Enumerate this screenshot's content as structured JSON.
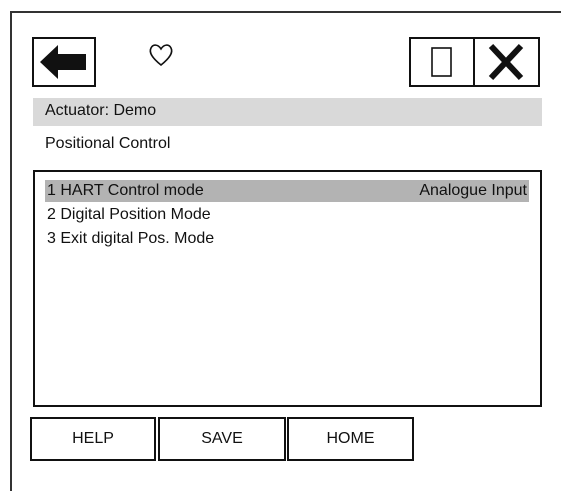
{
  "toolbar": {
    "back_icon": "arrow-left-icon",
    "favorite_icon": "heart-outline-icon",
    "window_icon": "window-icon",
    "close_icon": "close-icon"
  },
  "header": {
    "actuator_label": "Actuator: Demo"
  },
  "page": {
    "title": "Positional Control"
  },
  "menu": {
    "items": [
      {
        "label": "1 HART Control mode",
        "value": "Analogue Input",
        "selected": true
      },
      {
        "label": "2 Digital Position Mode",
        "value": "",
        "selected": false
      },
      {
        "label": "3 Exit digital Pos. Mode",
        "value": "",
        "selected": false
      }
    ]
  },
  "footer": {
    "help_label": "HELP",
    "save_label": "SAVE",
    "home_label": "HOME"
  },
  "colors": {
    "header_bg": "#d9d9d9",
    "selected_bg": "#b3b3b3"
  }
}
